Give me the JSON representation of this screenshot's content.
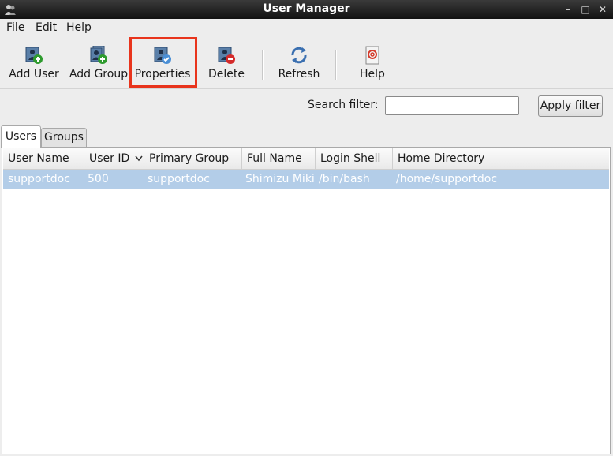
{
  "window": {
    "title": "User Manager"
  },
  "menubar": {
    "items": [
      "File",
      "Edit",
      "Help"
    ]
  },
  "toolbar": {
    "add_user": "Add User",
    "add_group": "Add Group",
    "properties": "Properties",
    "delete": "Delete",
    "refresh": "Refresh",
    "help": "Help"
  },
  "filter": {
    "label": "Search filter:",
    "value": "",
    "apply_label": "Apply filter"
  },
  "tabs": [
    {
      "label": "Users",
      "active": true
    },
    {
      "label": "Groups",
      "active": false
    }
  ],
  "table": {
    "columns": [
      "User Name",
      "User ID",
      "Primary Group",
      "Full Name",
      "Login Shell",
      "Home Directory"
    ],
    "rows": [
      [
        "supportdoc",
        "500",
        "supportdoc",
        "Shimizu Miki",
        "/bin/bash",
        "/home/supportdoc"
      ]
    ]
  },
  "colors": {
    "highlight": "#e8341c",
    "selected_row": "#b3cde8"
  }
}
